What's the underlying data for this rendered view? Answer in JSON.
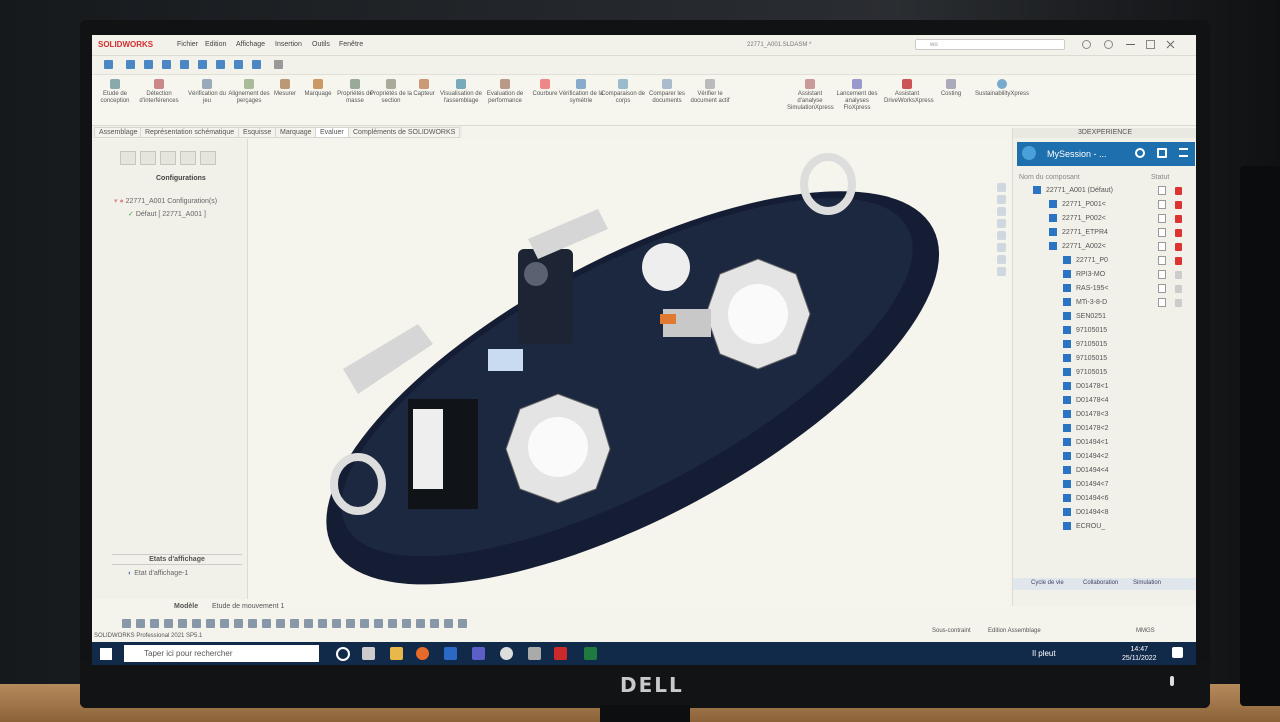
{
  "app": {
    "brand": "SOLIDWORKS",
    "document_title": "22771_A001.SLDASM *",
    "search_placeholder": "wo",
    "menus": [
      "Fichier",
      "Edition",
      "Affichage",
      "Insertion",
      "Outils",
      "Fenêtre"
    ]
  },
  "ribbon": {
    "buttons": [
      "Etude de conception",
      "Détection d'interférences",
      "Vérification du jeu",
      "Alignement des perçages",
      "Mesurer",
      "Marquage",
      "Propriétés de masse",
      "Propriétés de la section",
      "Capteur",
      "Visualisation de l'assemblage",
      "Evaluation de performance",
      "Courbure",
      "Vérification de la symétrie",
      "Comparaison de corps",
      "Comparer les documents",
      "Vérifier le document actif",
      "Assistant d'analyse SimulationXpress",
      "Lancement des analyses FloXpress",
      "Assistant DriveWorksXpress",
      "Costing",
      "SustainabilityXpress"
    ]
  },
  "tabs": [
    "Assemblage",
    "Représentation schématique",
    "Esquisse",
    "Marquage",
    "Evaluer",
    "Compléments de SOLIDWORKS"
  ],
  "left_panel": {
    "title": "Configurations",
    "config_root": "22771_A001 Configuration(s)",
    "config_child": "Défaut [ 22771_A001 ]",
    "display_states_title": "Etats d'affichage",
    "display_state": "Etat d'affichage-1"
  },
  "right_panel": {
    "header": "3DEXPERIENCE",
    "session": "MySession - ...",
    "col_name": "Nom du composant",
    "col_status": "Statut",
    "components": [
      "22771_A001 (Défaut)",
      "22771_P001<",
      "22771_P002<",
      "22771_ETPR4",
      "22771_A002<",
      "22771_P0",
      "RPI3-MO",
      "RAS-195<",
      "MTi-3-8-D",
      "SEN0251",
      "97105015",
      "97105015",
      "97105015",
      "97105015",
      "D01478<1",
      "D01478<4",
      "D01478<3",
      "D01478<2",
      "D01494<1",
      "D01494<2",
      "D01494<4",
      "D01494<7",
      "D01494<6",
      "D01494<8",
      "ECROU_"
    ],
    "footer_tabs": [
      "Cycle de vie",
      "Collaboration",
      "Simulation"
    ]
  },
  "bottom_tabs": [
    "Modèle",
    "Etude de mouvement 1"
  ],
  "statusbar": {
    "left": "SOLIDWORKS Professional 2021 SP5.1",
    "sous_contraint": "Sous-contraint",
    "mode": "Edition Assemblage",
    "units": "MMGS"
  },
  "taskbar": {
    "search_placeholder": "Taper ici pour rechercher",
    "weather": "Il pleut",
    "time": "14:47",
    "date": "25/11/2022"
  },
  "monitor": {
    "logo": "DELL"
  }
}
